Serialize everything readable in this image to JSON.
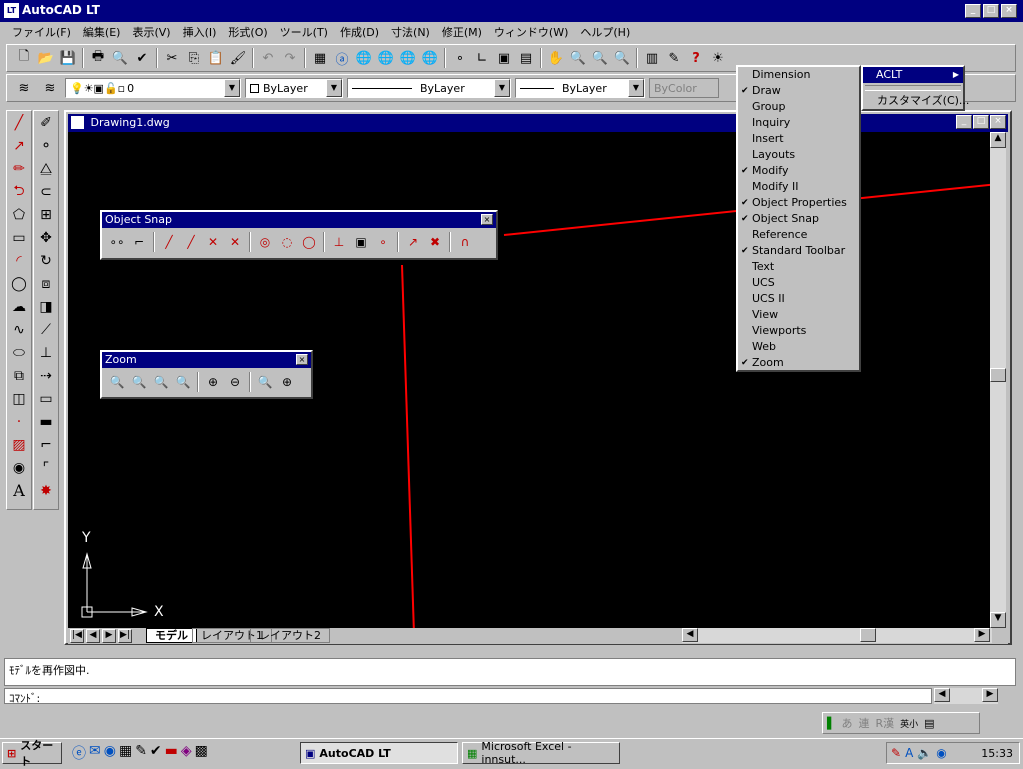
{
  "app": {
    "title": "AutoCAD LT",
    "icon_label": "LT"
  },
  "menubar": [
    "ファイル(F)",
    "編集(E)",
    "表示(V)",
    "挿入(I)",
    "形式(O)",
    "ツール(T)",
    "作成(D)",
    "寸法(N)",
    "修正(M)",
    "ウィンドウ(W)",
    "ヘルプ(H)"
  ],
  "properties": {
    "layer_value": "0",
    "color_value": "ByLayer",
    "linetype_value": "ByLayer",
    "lineweight_value": "ByLayer",
    "plotstyle_value": "ByColor"
  },
  "document": {
    "title": "Drawing1.dwg",
    "tabs": [
      "モデル",
      "レイアウト1",
      "レイアウト2"
    ],
    "axis_x": "X",
    "axis_y": "Y"
  },
  "object_snap_toolbar": {
    "title": "Object Snap",
    "icons": [
      "temp-track-icon",
      "snap-from-icon",
      "endpoint-icon",
      "midpoint-icon",
      "intersection-icon",
      "apparent-intersection-icon",
      "center-icon",
      "quadrant-icon",
      "tangent-icon",
      "perpendicular-icon",
      "insert-icon",
      "node-icon",
      "nearest-icon",
      "none-icon",
      "osnap-settings-icon"
    ]
  },
  "zoom_toolbar": {
    "title": "Zoom",
    "icons": [
      "zoom-window-icon",
      "zoom-dynamic-icon",
      "zoom-scale-icon",
      "zoom-center-icon",
      "zoom-in-icon",
      "zoom-out-icon",
      "zoom-all-icon",
      "zoom-extents-icon"
    ]
  },
  "toolbar_menu": {
    "items": [
      {
        "label": "Dimension",
        "checked": false
      },
      {
        "label": "Draw",
        "checked": true
      },
      {
        "label": "Group",
        "checked": false
      },
      {
        "label": "Inquiry",
        "checked": false
      },
      {
        "label": "Insert",
        "checked": false
      },
      {
        "label": "Layouts",
        "checked": false
      },
      {
        "label": "Modify",
        "checked": true
      },
      {
        "label": "Modify II",
        "checked": false
      },
      {
        "label": "Object Properties",
        "checked": true
      },
      {
        "label": "Object Snap",
        "checked": true
      },
      {
        "label": "Reference",
        "checked": false
      },
      {
        "label": "Standard Toolbar",
        "checked": true
      },
      {
        "label": "Text",
        "checked": false
      },
      {
        "label": "UCS",
        "checked": false
      },
      {
        "label": "UCS II",
        "checked": false
      },
      {
        "label": "View",
        "checked": false
      },
      {
        "label": "Viewports",
        "checked": false
      },
      {
        "label": "Web",
        "checked": false
      },
      {
        "label": "Zoom",
        "checked": true
      }
    ]
  },
  "submenu": {
    "aclt": "ACLT",
    "customize": "カスタマイズ(C)..."
  },
  "command": {
    "history": "ﾓﾃﾞﾙを再作図中.",
    "prompt": "ｺﾏﾝﾄﾞ:"
  },
  "ime": {
    "a": "あ",
    "ren": "連",
    "r": "R漢",
    "eisho": "英小"
  },
  "taskbar": {
    "start": "スタート",
    "task_autocad": "AutoCAD LT",
    "task_excel": "Microsoft Excel - innsut...",
    "clock": "15:33"
  }
}
